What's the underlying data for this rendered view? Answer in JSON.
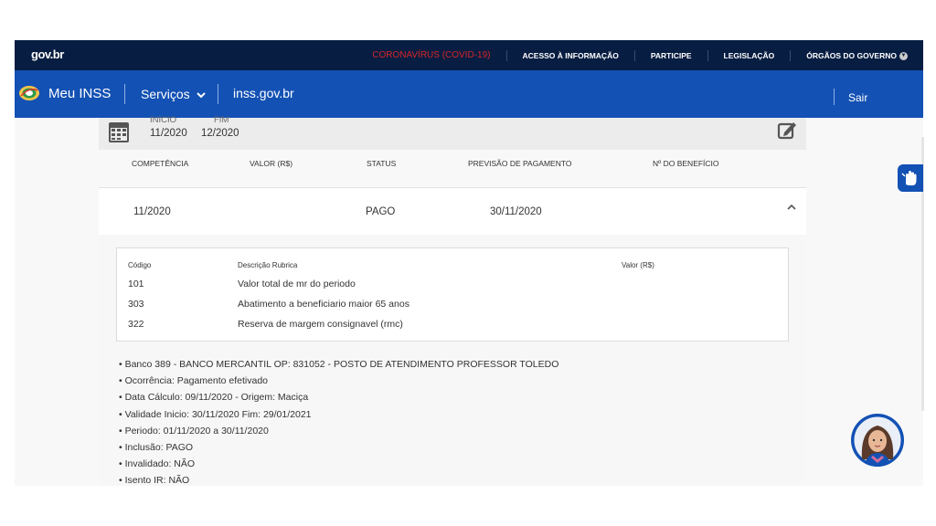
{
  "govbar": {
    "logo": "gov.br",
    "covid": "CORONAVÍRUS (COVID-19)",
    "links": [
      "ACESSO À INFORMAÇÃO",
      "PARTICIPE",
      "LEGISLAÇÃO",
      "ÓRGÃOS DO GOVERNO"
    ]
  },
  "header": {
    "brand": "Meu INSS",
    "servicos": "Serviços",
    "site": "inss.gov.br",
    "sair": "Sair"
  },
  "period": {
    "inicio_label": "INÍCIO",
    "inicio_value": "11/2020",
    "fim_label": "FIM",
    "fim_value": "12/2020"
  },
  "table": {
    "headers": [
      "COMPETÊNCIA",
      "VALOR (R$)",
      "STATUS",
      "PREVISÃO DE PAGAMENTO",
      "Nº DO BENEFÍCIO"
    ],
    "row": {
      "competencia": "11/2020",
      "valor": "",
      "status": "PAGO",
      "previsao": "30/11/2020",
      "beneficio": ""
    }
  },
  "rubricas": {
    "headers": {
      "codigo": "Código",
      "descricao": "Descrição Rubrica",
      "valor": "Valor (R$)"
    },
    "items": [
      {
        "codigo": "101",
        "descricao": "Valor total de mr do periodo",
        "valor": ""
      },
      {
        "codigo": "303",
        "descricao": "Abatimento a beneficiario maior 65 anos",
        "valor": ""
      },
      {
        "codigo": "322",
        "descricao": "Reserva de margem consignavel (rmc)",
        "valor": ""
      }
    ]
  },
  "info": [
    "• Banco 389 - BANCO MERCANTIL OP: 831052 - POSTO DE ATENDIMENTO PROFESSOR TOLEDO",
    "• Ocorrência: Pagamento efetivado",
    "• Data Cálculo: 09/11/2020 - Origem: Maciça",
    "• Validade Inicio: 30/11/2020 Fim: 29/01/2021",
    "• Periodo: 01/11/2020 a 30/11/2020",
    "• Inclusão: PAGO",
    "• Invalidado: NÃO",
    "• Isento IR: NÃO"
  ],
  "icons": {
    "calendar": "calendar-icon",
    "edit": "edit-icon",
    "caret": "chevron-up-icon",
    "accessibility": "sign-language-icon",
    "assistant": "assistant-avatar"
  },
  "colors": {
    "govbar": "#071d41",
    "header": "#1351b4",
    "covid": "#d8262b"
  }
}
